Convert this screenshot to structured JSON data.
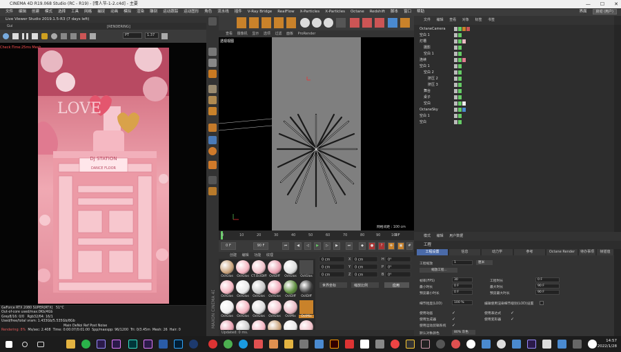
{
  "window": {
    "title": "CINEMA 4D R19.068 Studio (RC - R19) - [情人节-1-2.c4d] - 主要",
    "controls": [
      "—",
      "☐",
      "✕"
    ]
  },
  "menubar": {
    "items": [
      "文件",
      "编辑",
      "创建",
      "模式",
      "选择",
      "工具",
      "网格",
      "捕捉",
      "动画",
      "模拟",
      "渲染",
      "雕刻",
      "运动跟踪",
      "运动图形",
      "角色",
      "流水线",
      "插件",
      "V-Ray Bridge",
      "RealFlow",
      "X-Particles",
      "X-Particles",
      "Octane",
      "Redshift",
      "脚本",
      "窗口",
      "帮助"
    ],
    "layout_label": "界面",
    "layout_value": "启动 (用户)"
  },
  "live_viewer": {
    "title": "Live Viewer Studio 2019.1.5-R3 (7 days left)",
    "menu": "Gui",
    "rendering_label": "[RENDERING]",
    "mode_value": "PT",
    "zoom_value": "1.37",
    "check_time": "Check:Time:25ms  Mesh...",
    "status": {
      "gpu": "GeForce RTX 2080 SUPER[RTX]",
      "temp": "51°C",
      "out_of_core": "Out-of-core used/max:0Kb/4Gb",
      "grey": "Grey8/16: 0/0",
      "rgb": "Rgb32/64: 16/1",
      "vram": "Used/free/total vram: 1.433Gb/5.535Gb/8Gb",
      "tabs": "Main  DeNoi  Ref  Post  Noise",
      "rendering": "Rendering: 8%",
      "ms_sec": "Ms/sec: 2.408",
      "time": "Time: 0:00:07/0:01:00",
      "spp": "Spp/maxspp: 96/1200",
      "tri": "Tri: 0/3.45m",
      "mesh": "Mesh: 26",
      "hair": "Hair: 0"
    },
    "scene_text": [
      "LOVE",
      "DJ STATION",
      "DANCE FLOOR"
    ]
  },
  "viewport": {
    "menu": [
      "查看",
      "摄像机",
      "显示",
      "选项",
      "过滤",
      "面板",
      "ProRender"
    ],
    "label": "透视视图",
    "grid_label": "网格间距 : 100 cm"
  },
  "timeline": {
    "ticks": [
      "0",
      "10",
      "20",
      "30",
      "40",
      "50",
      "60",
      "70",
      "80",
      "90",
      "100"
    ],
    "current_frame": "0 F",
    "start": "0 F",
    "end": "90 F",
    "max": "90 F",
    "frame_display": "0 F"
  },
  "material_manager": {
    "menu": [
      "创建",
      "编辑",
      "功能",
      "纹理"
    ],
    "materials": [
      [
        "OctGlos",
        "OctGlos",
        "CT.OctDiff",
        "OctDiff",
        "OctGlos",
        "OctGlos"
      ],
      [
        "OctGlos",
        "OctGlos",
        "OctGlos",
        "OctGlos",
        "OctDiff",
        "OctDiff"
      ],
      [
        "OctGlos",
        "OctGlos",
        "OctGlos",
        "OctGlos",
        "OctMix",
        "OctMix"
      ],
      [
        "OctGlos",
        "OctGlos",
        "OctGlos",
        "OctDiff",
        "OctDiff",
        "OctDiff"
      ]
    ],
    "mix_label": "OctMix",
    "status": "Updated: 0 ms."
  },
  "coords": {
    "x": "0 cm",
    "y": "0 cm",
    "z": "0 cm",
    "h": "0°",
    "p": "0°",
    "b": "0°",
    "mode1": "世界坐标",
    "mode2": "缩放比例",
    "apply": "应用"
  },
  "object_manager": {
    "menu": [
      "文件",
      "编辑",
      "查看",
      "对象",
      "标签",
      "书签"
    ],
    "objects": [
      {
        "name": "OctaneCamera",
        "indent": 0
      },
      {
        "name": "空白 1",
        "indent": 0
      },
      {
        "name": "灯槽",
        "indent": 0
      },
      {
        "name": "摄影",
        "indent": 1
      },
      {
        "name": "空白 1",
        "indent": 1
      },
      {
        "name": "连续",
        "indent": 0
      },
      {
        "name": "空白 1",
        "indent": 0
      },
      {
        "name": "空白 2",
        "indent": 1
      },
      {
        "name": "挤压 2",
        "indent": 2
      },
      {
        "name": "挤压 3",
        "indent": 2
      },
      {
        "name": "舞台",
        "indent": 1
      },
      {
        "name": "桌子",
        "indent": 1
      },
      {
        "name": "空白",
        "indent": 1
      },
      {
        "name": "OctaneSky",
        "indent": 0
      },
      {
        "name": "空白 1",
        "indent": 0
      },
      {
        "name": "空白",
        "indent": 0
      }
    ]
  },
  "attribute_manager": {
    "menu": [
      "模式",
      "编辑",
      "用户数据"
    ],
    "title": "工程",
    "tabs": [
      "工程设置",
      "信息",
      "动力学",
      "参考",
      "Octane Render",
      "待办事项",
      "帧插值"
    ],
    "scale_label": "工程缩放",
    "scale_value": "1",
    "scale_unit": "厘米",
    "scale_button": "缩放工程...",
    "fields": [
      {
        "label": "帧率(FPS)",
        "value": "30"
      },
      {
        "label": "最小时长",
        "value": "0 F"
      },
      {
        "label": "预览最小时长",
        "value": "0 F"
      },
      {
        "label": "细节程度(LOD)",
        "value": "100 %"
      }
    ],
    "fields_right": [
      {
        "label": "工程时长",
        "value": "0 F"
      },
      {
        "label": "最大时长",
        "value": "90 F"
      },
      {
        "label": "预览最大时长",
        "value": "90 F"
      }
    ],
    "lod_render": "编辑使用渲染细节级别(LOD)设置",
    "checks_left": [
      "使用动画",
      "使用生成器",
      "使用运动剪辑系统"
    ],
    "checks_right": [
      "使用表达式",
      "使用变形器"
    ],
    "default_label": "默认对象颜色",
    "default_value": "80% 灰色"
  },
  "taskbar": {
    "time": "14:57",
    "date": "2022/1/28",
    "icons": [
      "windows-start",
      "search",
      "task-view",
      "file-explorer",
      "wechat",
      "after-effects",
      "premiere",
      "audition",
      "premiere-pro",
      "mail",
      "photoshop",
      "cinema4d",
      "red-app",
      "chrome",
      "edge",
      "app-a",
      "app-b",
      "folder",
      "app-c",
      "app-d",
      "illustrator",
      "app-e",
      "app-f",
      "app-g",
      "mindmaster",
      "davinci",
      "app-h",
      "unreal",
      "app-i",
      "after-effects-2",
      "app-j",
      "unreal-2",
      "app-k"
    ]
  },
  "colors": {
    "accent_blue": "#4a6aa8",
    "render_pink": "#f0a9b3",
    "status_red": "#e35b5b",
    "octane_green": "#58c14a"
  }
}
